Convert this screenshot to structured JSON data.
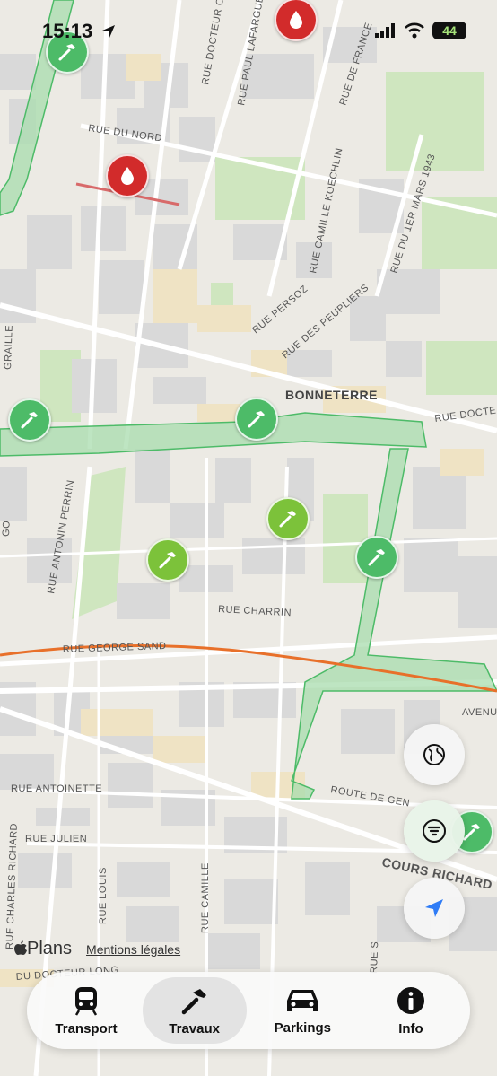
{
  "status_bar": {
    "time": "15:13",
    "battery": "44"
  },
  "map": {
    "district": "BONNETERRE",
    "streets": {
      "rue_docteur_olli": "RUE DOCTEUR OLLI",
      "rue_paul_lafargue": "RUE PAUL LAFARGUE",
      "rue_de_france": "RUE DE FRANCE",
      "rue_du_nord": "RUE DU NORD",
      "rue_camille_koechlin": "RUE CAMILLE KOECHLIN",
      "rue_du_1er_mars_1943": "RUE DU 1ER MARS 1943",
      "rue_persoz": "RUE PERSOZ",
      "rue_des_peupliers": "RUE DES PEUPLIERS",
      "rue_docte": "RUE DOCTE",
      "graille": "GRAILLE",
      "rue_antonin_perrin": "RUE ANTONIN PERRIN",
      "rue_charrin": "RUE CHARRIN",
      "rue_george_sand": "RUE GEORGE SAND",
      "avenu": "AVENU",
      "rue_antoinette": "RUE ANTOINETTE",
      "rue_julien": "RUE JULIEN",
      "route_de_gen": "ROUTE DE GEN",
      "cours_richard": "COURS RICHARD V",
      "rue_charles_richard": "RUE CHARLES RICHARD",
      "rue_louis": "RUE LOUIS",
      "rue_camille": "RUE CAMILLE",
      "du_docteur_long": "DU DOCTEUR LONG",
      "rue_s": "RUE S",
      "go": "GO"
    }
  },
  "legal": {
    "plans": "Plans",
    "mentions": "Mentions légales"
  },
  "tabs": [
    {
      "label": "Transport",
      "icon": "tram-icon"
    },
    {
      "label": "Travaux",
      "icon": "hammer-icon"
    },
    {
      "label": "Parkings",
      "icon": "car-icon"
    },
    {
      "label": "Info",
      "icon": "info-icon"
    }
  ],
  "colors": {
    "worksite_green": "#4dbb68",
    "worksite_lime": "#7cc23a",
    "water_red": "#d22b2b",
    "tram_route": "#e8702a",
    "park": "#cfe6bf",
    "building": "#dcdcdc",
    "highlight_building": "#efe3c4"
  }
}
